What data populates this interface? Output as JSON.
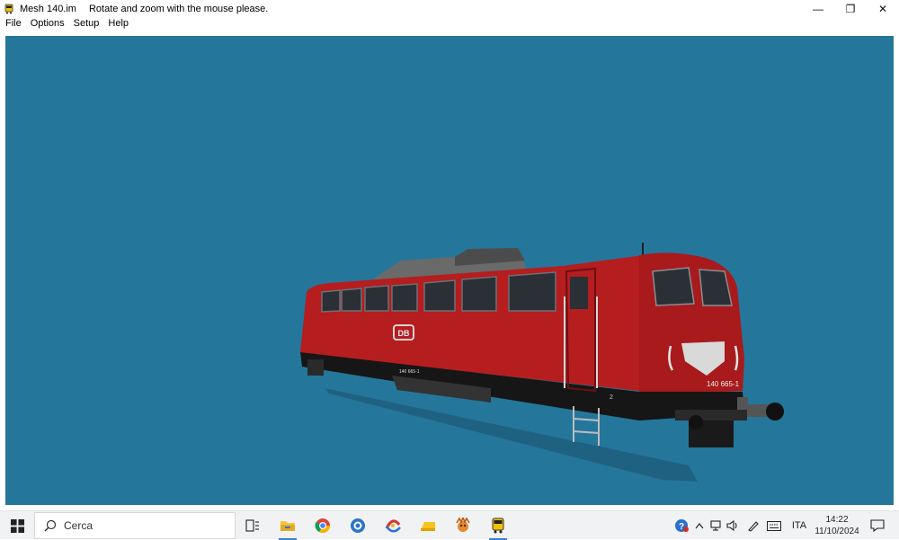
{
  "window": {
    "title": "Mesh 140.im",
    "hint": "Rotate and zoom with the mouse please.",
    "controls": {
      "minimize": "—",
      "restore": "❐",
      "close": "✕"
    }
  },
  "menu": {
    "items": [
      "File",
      "Options",
      "Setup",
      "Help"
    ]
  },
  "scene": {
    "background_color": "#25769b",
    "body_color": "#b51d1f",
    "number_plate": "140 665-1",
    "side_number": "140 665-1",
    "logo_text": "DB",
    "bogie_number": "2"
  },
  "taskbar": {
    "search_placeholder": "Cerca",
    "apps": [
      "task-view-icon",
      "file-explorer-icon",
      "chrome-icon",
      "app-icon-blue",
      "app-icon-red",
      "app-icon-yellow",
      "app-icon-game",
      "train-app-icon"
    ],
    "language": "ITA",
    "time": "14:22",
    "date": "11/10/2024"
  }
}
